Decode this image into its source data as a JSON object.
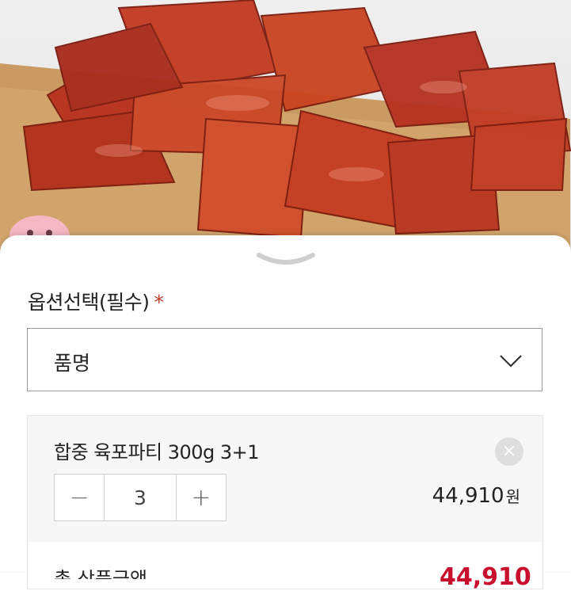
{
  "option": {
    "label": "옵션선택(필수)",
    "required_mark": "*",
    "select_value": "품명"
  },
  "item": {
    "name": "합중 육포파티 300g 3+1",
    "quantity": "3",
    "minus": "−",
    "plus": "+",
    "remove": "×",
    "price": "44,910",
    "currency": "원"
  },
  "total": {
    "label": "총 상품금액",
    "price": "44,910"
  },
  "colors": {
    "accent": "#c8102e",
    "required": "#c0392b"
  }
}
